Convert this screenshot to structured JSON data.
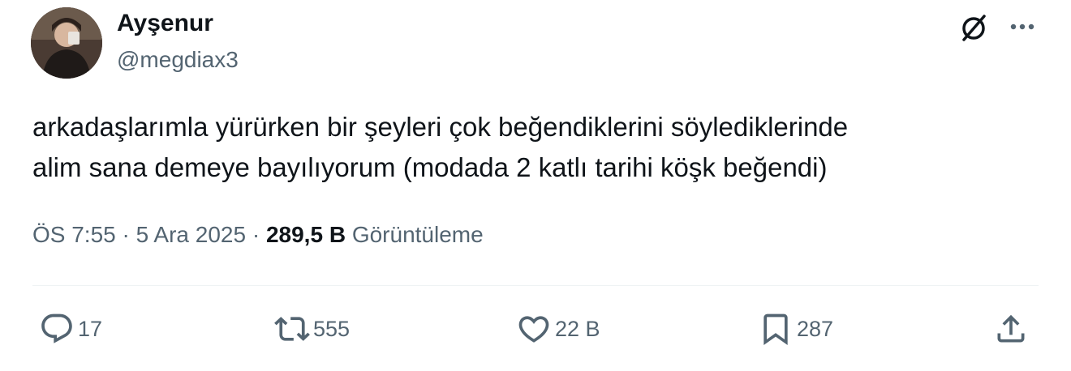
{
  "author": {
    "display_name": "Ayşenur",
    "handle": "@megdiax3"
  },
  "tweet": {
    "text": "arkadaşlarımla yürürken bir şeyleri çok beğendiklerini söylediklerinde\nalim sana demeye bayılıyorum (modada 2 katlı tarihi köşk beğendi)"
  },
  "meta": {
    "time": "ÖS 7:55",
    "separator1": " · ",
    "date": "5 Ara 2025",
    "separator2": " · ",
    "views_count": "289,5 B",
    "views_label": " Görüntüleme"
  },
  "actions": {
    "replies": "17",
    "reposts": "555",
    "likes": "22 B",
    "bookmarks": "287"
  },
  "icons": {
    "top_right": [
      "grok-icon",
      "more-icon"
    ],
    "actions": [
      "reply-icon",
      "repost-icon",
      "like-icon",
      "bookmark-icon",
      "share-icon"
    ]
  },
  "colors": {
    "text_primary": "#0f1419",
    "text_secondary": "#536471",
    "divider": "#eff3f4"
  }
}
